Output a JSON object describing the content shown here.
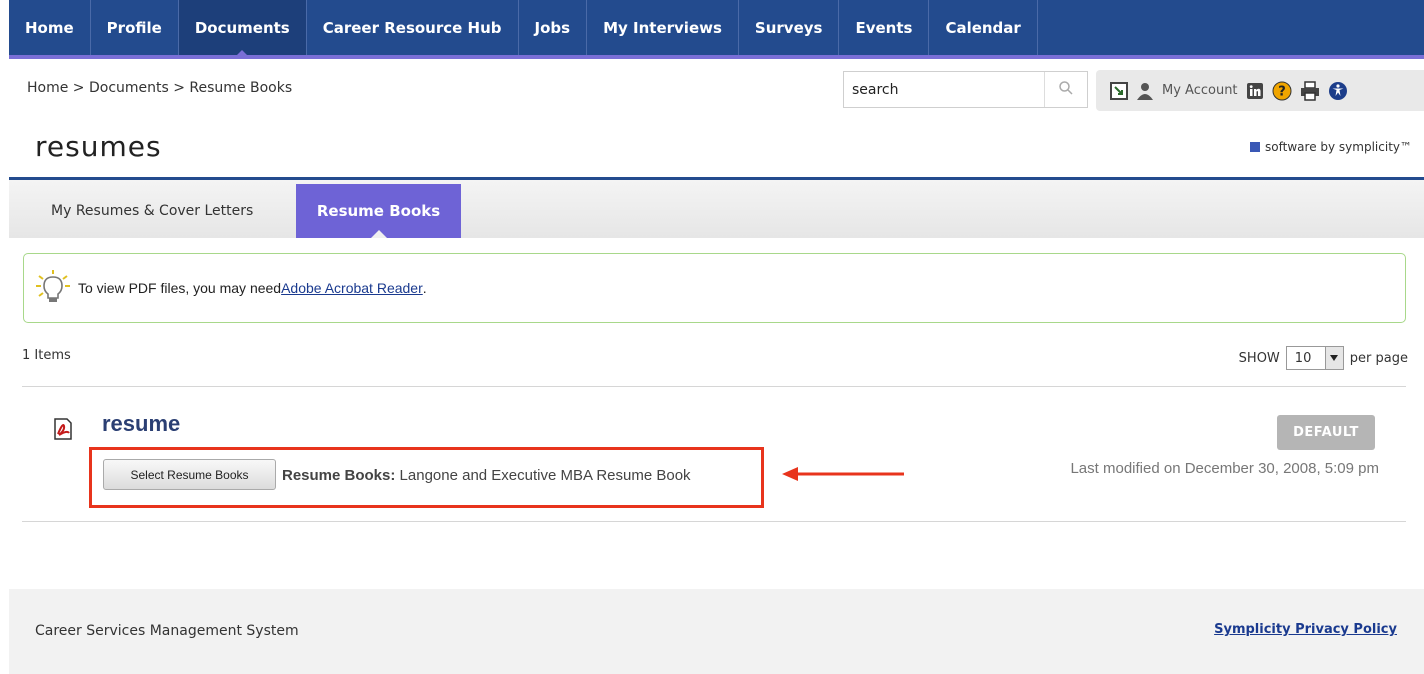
{
  "nav": {
    "items": [
      {
        "label": "Home"
      },
      {
        "label": "Profile"
      },
      {
        "label": "Documents",
        "active": true
      },
      {
        "label": "Career Resource Hub"
      },
      {
        "label": "Jobs"
      },
      {
        "label": "My Interviews"
      },
      {
        "label": "Surveys"
      },
      {
        "label": "Events"
      },
      {
        "label": "Calendar"
      }
    ]
  },
  "breadcrumb": {
    "text": "Home > Documents > Resume Books"
  },
  "search": {
    "value": "search"
  },
  "utility": {
    "account_label": "My Account"
  },
  "page": {
    "title": "resumes",
    "brand": "software by symplicity™"
  },
  "tabs": [
    {
      "label": "My Resumes & Cover Letters"
    },
    {
      "label": "Resume Books",
      "active": true
    }
  ],
  "notice": {
    "text": "To view PDF files, you may need ",
    "link": "Adobe Acrobat Reader",
    "suffix": "."
  },
  "list": {
    "count": "1 Items",
    "show_label": "SHOW",
    "per_page_value": "10",
    "per_page_label": "per page"
  },
  "resume": {
    "title": "resume",
    "default_label": "DEFAULT",
    "last_modified": "Last modified on December 30, 2008, 5:09 pm",
    "select_button": "Select Resume Books",
    "books_label": "Resume Books:",
    "books_value": " Langone and Executive MBA Resume Book"
  },
  "footer": {
    "left": "Career Services Management System",
    "right": "Symplicity Privacy Policy"
  },
  "colors": {
    "nav_bg": "#234b8e",
    "accent_purple": "#6e63d6",
    "annotation_red": "#e8341c"
  }
}
